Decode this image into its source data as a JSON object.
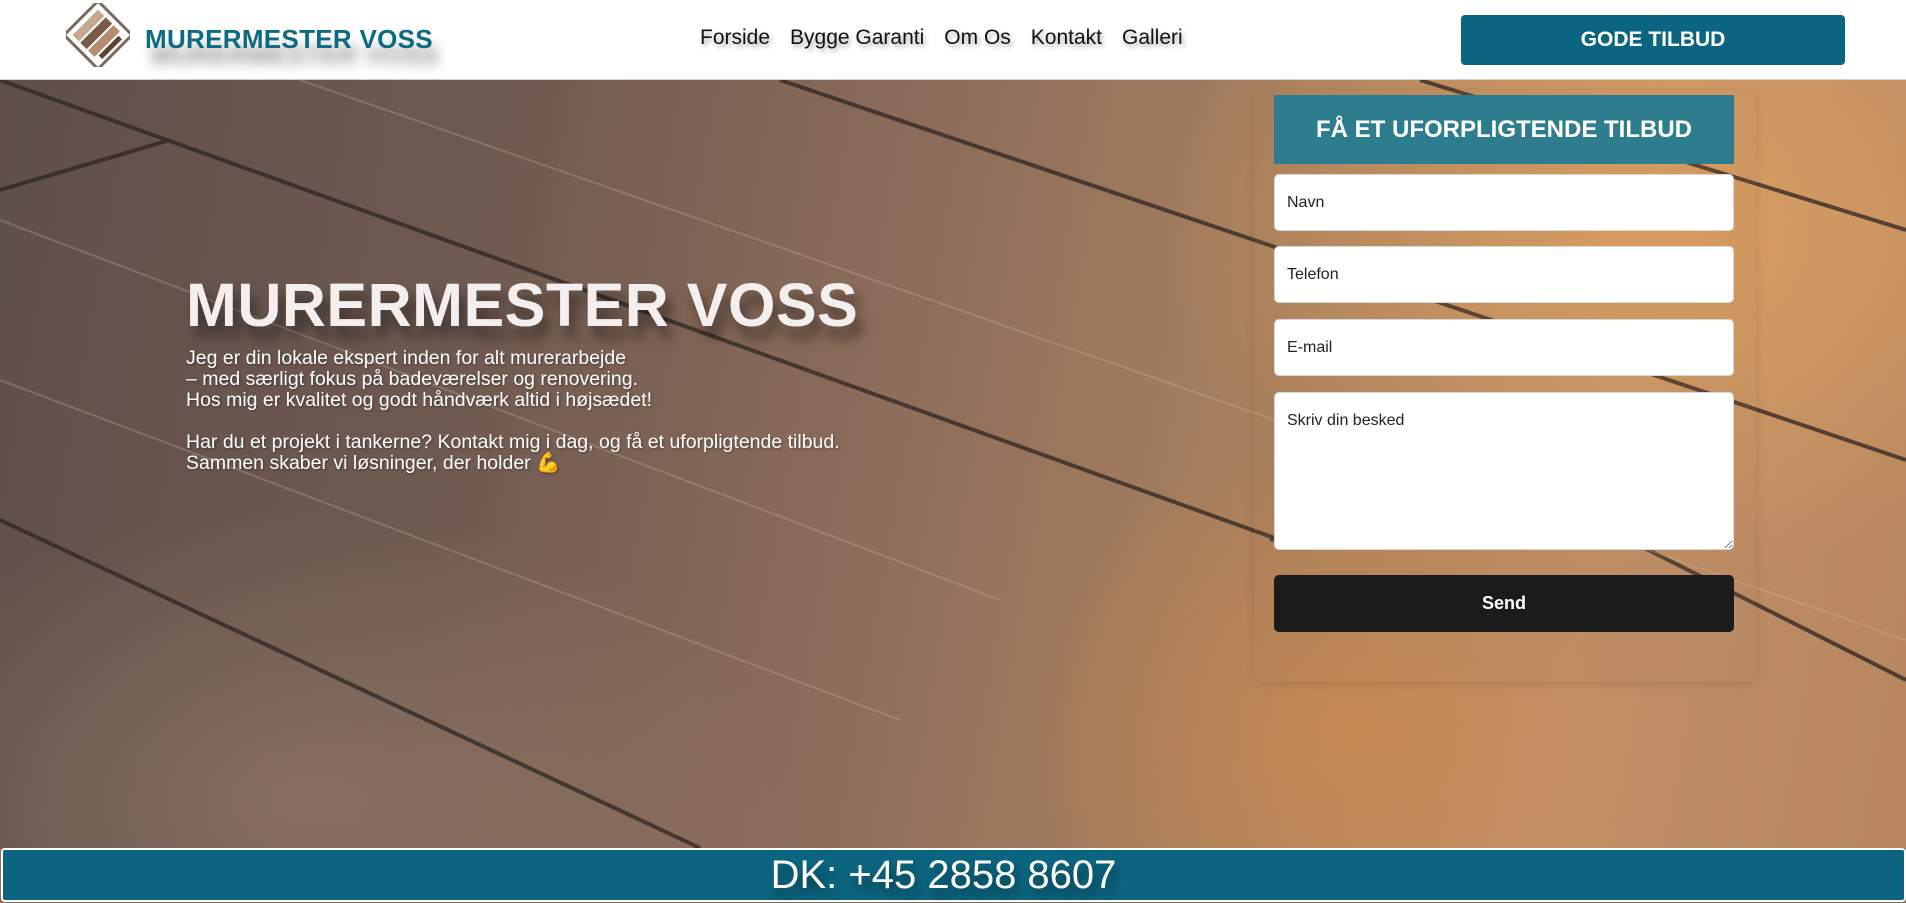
{
  "header": {
    "brand": "MURERMESTER VOSS",
    "nav": [
      {
        "label": "Forside"
      },
      {
        "label": "Bygge Garanti"
      },
      {
        "label": "Om Os"
      },
      {
        "label": "Kontakt"
      },
      {
        "label": "Galleri"
      }
    ],
    "cta_label": "GODE TILBUD"
  },
  "hero": {
    "title": "MURERMESTER VOSS",
    "lines": [
      "Jeg er din lokale ekspert inden for alt murerarbejde",
      "– med særligt fokus på badeværelser og renovering.",
      "Hos mig er kvalitet og godt håndværk altid i højsædet!",
      "Har du et projekt i tankerne? Kontakt mig i dag, og få et uforpligtende tilbud.",
      "Sammen skaber vi løsninger, der holder 💪"
    ]
  },
  "form": {
    "heading": "FÅ ET UFORPLIGTENDE TILBUD",
    "name_placeholder": "Navn",
    "phone_placeholder": "Telefon",
    "email_placeholder": "E-mail",
    "message_placeholder": "Skriv din besked",
    "send_label": "Send"
  },
  "footer": {
    "phone": "DK: +45 2858 8607"
  },
  "colors": {
    "brand_teal": "#0c6580",
    "form_heading_bg": "#2e7d8e",
    "send_button_bg": "#1b1b1b"
  },
  "icons": {
    "logo": "brick-logo-icon"
  }
}
